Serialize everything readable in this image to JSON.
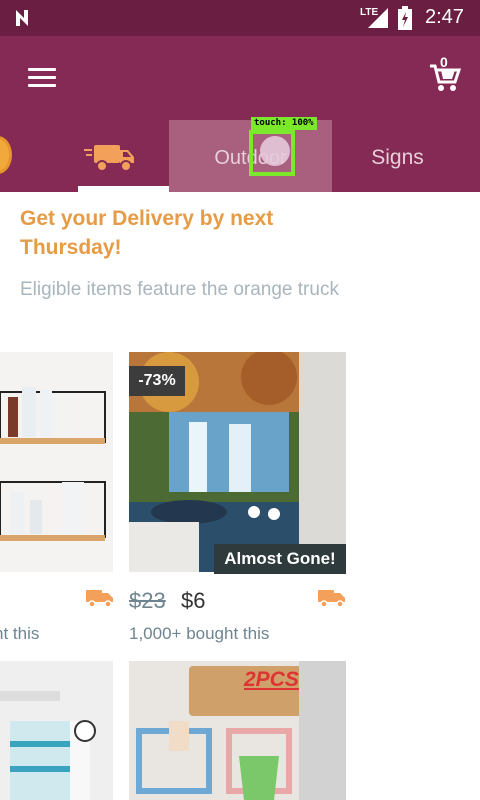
{
  "status_bar": {
    "network": "LTE",
    "time": "2:47"
  },
  "app_bar": {
    "cart_count": "0"
  },
  "tabs": [
    {
      "label": "Outdoor"
    },
    {
      "label": "Signs"
    }
  ],
  "touch_overlay": {
    "label": "touch: 100%"
  },
  "banner": {
    "headline": "Get your Delivery by next Thursday!",
    "subline": "Eligible items feature the orange truck"
  },
  "products": [
    {
      "bought": "ht this"
    },
    {
      "badge": "-73%",
      "status": "Almost Gone!",
      "old_price": "$23",
      "price": "$6",
      "bought": "1,000+ bought this"
    },
    {},
    {
      "sticker": "2PCS"
    }
  ],
  "colors": {
    "primary": "#852a54",
    "status_bar": "#6a1f42",
    "accent": "#e69b46",
    "touch": "#7be82b"
  }
}
